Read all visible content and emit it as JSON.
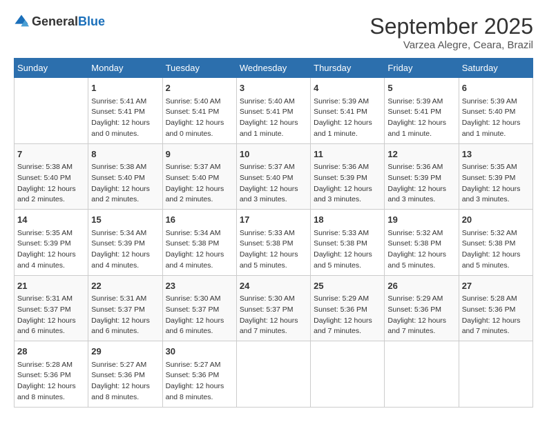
{
  "header": {
    "logo_general": "General",
    "logo_blue": "Blue",
    "month": "September 2025",
    "location": "Varzea Alegre, Ceara, Brazil"
  },
  "days_of_week": [
    "Sunday",
    "Monday",
    "Tuesday",
    "Wednesday",
    "Thursday",
    "Friday",
    "Saturday"
  ],
  "weeks": [
    [
      {
        "day": "",
        "info": ""
      },
      {
        "day": "1",
        "info": "Sunrise: 5:41 AM\nSunset: 5:41 PM\nDaylight: 12 hours\nand 0 minutes."
      },
      {
        "day": "2",
        "info": "Sunrise: 5:40 AM\nSunset: 5:41 PM\nDaylight: 12 hours\nand 0 minutes."
      },
      {
        "day": "3",
        "info": "Sunrise: 5:40 AM\nSunset: 5:41 PM\nDaylight: 12 hours\nand 1 minute."
      },
      {
        "day": "4",
        "info": "Sunrise: 5:39 AM\nSunset: 5:41 PM\nDaylight: 12 hours\nand 1 minute."
      },
      {
        "day": "5",
        "info": "Sunrise: 5:39 AM\nSunset: 5:41 PM\nDaylight: 12 hours\nand 1 minute."
      },
      {
        "day": "6",
        "info": "Sunrise: 5:39 AM\nSunset: 5:40 PM\nDaylight: 12 hours\nand 1 minute."
      }
    ],
    [
      {
        "day": "7",
        "info": "Sunrise: 5:38 AM\nSunset: 5:40 PM\nDaylight: 12 hours\nand 2 minutes."
      },
      {
        "day": "8",
        "info": "Sunrise: 5:38 AM\nSunset: 5:40 PM\nDaylight: 12 hours\nand 2 minutes."
      },
      {
        "day": "9",
        "info": "Sunrise: 5:37 AM\nSunset: 5:40 PM\nDaylight: 12 hours\nand 2 minutes."
      },
      {
        "day": "10",
        "info": "Sunrise: 5:37 AM\nSunset: 5:40 PM\nDaylight: 12 hours\nand 3 minutes."
      },
      {
        "day": "11",
        "info": "Sunrise: 5:36 AM\nSunset: 5:39 PM\nDaylight: 12 hours\nand 3 minutes."
      },
      {
        "day": "12",
        "info": "Sunrise: 5:36 AM\nSunset: 5:39 PM\nDaylight: 12 hours\nand 3 minutes."
      },
      {
        "day": "13",
        "info": "Sunrise: 5:35 AM\nSunset: 5:39 PM\nDaylight: 12 hours\nand 3 minutes."
      }
    ],
    [
      {
        "day": "14",
        "info": "Sunrise: 5:35 AM\nSunset: 5:39 PM\nDaylight: 12 hours\nand 4 minutes."
      },
      {
        "day": "15",
        "info": "Sunrise: 5:34 AM\nSunset: 5:39 PM\nDaylight: 12 hours\nand 4 minutes."
      },
      {
        "day": "16",
        "info": "Sunrise: 5:34 AM\nSunset: 5:38 PM\nDaylight: 12 hours\nand 4 minutes."
      },
      {
        "day": "17",
        "info": "Sunrise: 5:33 AM\nSunset: 5:38 PM\nDaylight: 12 hours\nand 5 minutes."
      },
      {
        "day": "18",
        "info": "Sunrise: 5:33 AM\nSunset: 5:38 PM\nDaylight: 12 hours\nand 5 minutes."
      },
      {
        "day": "19",
        "info": "Sunrise: 5:32 AM\nSunset: 5:38 PM\nDaylight: 12 hours\nand 5 minutes."
      },
      {
        "day": "20",
        "info": "Sunrise: 5:32 AM\nSunset: 5:38 PM\nDaylight: 12 hours\nand 5 minutes."
      }
    ],
    [
      {
        "day": "21",
        "info": "Sunrise: 5:31 AM\nSunset: 5:37 PM\nDaylight: 12 hours\nand 6 minutes."
      },
      {
        "day": "22",
        "info": "Sunrise: 5:31 AM\nSunset: 5:37 PM\nDaylight: 12 hours\nand 6 minutes."
      },
      {
        "day": "23",
        "info": "Sunrise: 5:30 AM\nSunset: 5:37 PM\nDaylight: 12 hours\nand 6 minutes."
      },
      {
        "day": "24",
        "info": "Sunrise: 5:30 AM\nSunset: 5:37 PM\nDaylight: 12 hours\nand 7 minutes."
      },
      {
        "day": "25",
        "info": "Sunrise: 5:29 AM\nSunset: 5:36 PM\nDaylight: 12 hours\nand 7 minutes."
      },
      {
        "day": "26",
        "info": "Sunrise: 5:29 AM\nSunset: 5:36 PM\nDaylight: 12 hours\nand 7 minutes."
      },
      {
        "day": "27",
        "info": "Sunrise: 5:28 AM\nSunset: 5:36 PM\nDaylight: 12 hours\nand 7 minutes."
      }
    ],
    [
      {
        "day": "28",
        "info": "Sunrise: 5:28 AM\nSunset: 5:36 PM\nDaylight: 12 hours\nand 8 minutes."
      },
      {
        "day": "29",
        "info": "Sunrise: 5:27 AM\nSunset: 5:36 PM\nDaylight: 12 hours\nand 8 minutes."
      },
      {
        "day": "30",
        "info": "Sunrise: 5:27 AM\nSunset: 5:36 PM\nDaylight: 12 hours\nand 8 minutes."
      },
      {
        "day": "",
        "info": ""
      },
      {
        "day": "",
        "info": ""
      },
      {
        "day": "",
        "info": ""
      },
      {
        "day": "",
        "info": ""
      }
    ]
  ]
}
